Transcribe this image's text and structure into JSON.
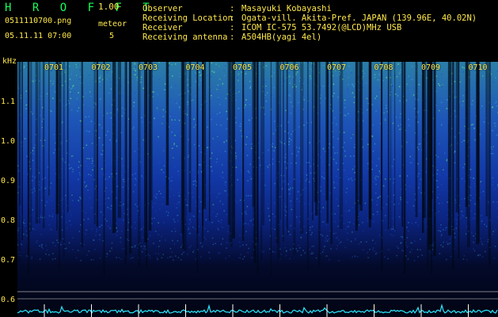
{
  "app": {
    "title": "H R O F F T",
    "version": "1.00"
  },
  "file": {
    "name": "0511110700.png",
    "datetime": "05.11.11 07:00"
  },
  "meteor": {
    "label": "meteor",
    "count": "5"
  },
  "info": [
    {
      "key": "Observer",
      "value": "Masayuki Kobayashi"
    },
    {
      "key": "Receiving Location",
      "value": "Ogata-vill. Akita-Pref. JAPAN (139.96E, 40.02N)"
    },
    {
      "key": "Receiver",
      "value": "ICOM IC-575 53.7492(@LCD)MHz USB"
    },
    {
      "key": "Receiving antenna",
      "value": "A504HB(yagi 4el)"
    }
  ],
  "axis": {
    "unit": "kHz",
    "y_ticks": [
      "1.1",
      "1.0",
      "0.9",
      "0.8",
      "0.7",
      "0.6"
    ],
    "time_ticks": [
      "0701",
      "0702",
      "0703",
      "0704",
      "0705",
      "0706",
      "0707",
      "0708",
      "0709",
      "0710"
    ]
  },
  "colors": {
    "label": "#ffe84a",
    "title": "#19ff5a",
    "baseline": "#29e6ff",
    "marker": "#ffffff"
  }
}
